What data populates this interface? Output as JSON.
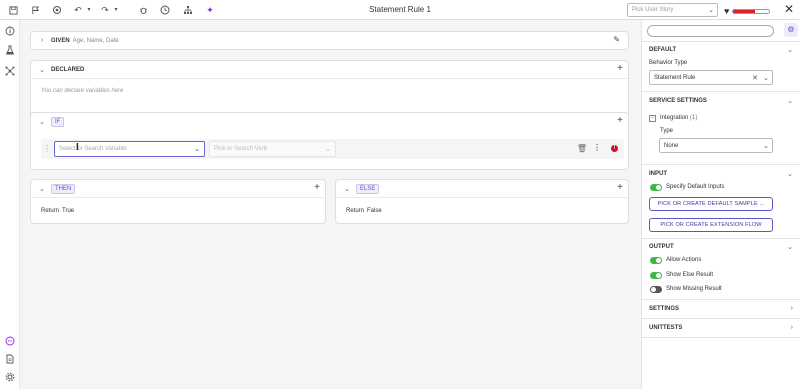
{
  "window": {
    "title": "Statement Rule 1",
    "user_story_placeholder": "Pick User Story",
    "health_fraction": 0.6,
    "toolbar_icons": [
      "save-icon",
      "flag-icon",
      "bug-report-icon",
      "undo-icon",
      "redo-icon",
      "debugger-icon",
      "history-icon",
      "hierarchy-icon",
      "sparkle-icon"
    ]
  },
  "left_rail": {
    "icons": [
      "info-icon",
      "flask-icon",
      "network-icon",
      "chat-icon",
      "document-icon",
      "settings-icon"
    ]
  },
  "sections": {
    "given": {
      "label": "GIVEN",
      "sublabel": "Age, Name, Date"
    },
    "declared": {
      "label": "DECLARED",
      "placeholder": "You can declare variables here"
    },
    "if": {
      "label": "IF",
      "variable_placeholder": "Select or Search Variable",
      "verb_placeholder": "Pick or Search Verb"
    },
    "then": {
      "label": "THEN",
      "return_label": "Return",
      "return_value": "True"
    },
    "else": {
      "label": "ELSE",
      "return_label": "Return",
      "return_value": "False"
    }
  },
  "right_panel": {
    "default": {
      "title": "DEFAULT",
      "behavior_type_label": "Behavior Type",
      "behavior_type_value": "Statement Rule"
    },
    "service_settings": {
      "title": "SERVICE SETTINGS",
      "integration_label": "Integration",
      "integration_count": "(1)",
      "type_label": "Type",
      "type_value": "None"
    },
    "input": {
      "title": "INPUT",
      "specify_default_inputs": "Specify Default Inputs",
      "sample_button": "PICK OR CREATE DEFAULT SAMPLE ...",
      "extension_button": "PICK OR CREATE EXTENSION FLOW"
    },
    "output": {
      "title": "OUTPUT",
      "toggles": [
        {
          "label": "Allow Actions",
          "on": true
        },
        {
          "label": "Show Else Result",
          "on": true
        },
        {
          "label": "Show Missing Result",
          "on": false
        }
      ]
    },
    "settings": {
      "title": "SETTINGS"
    },
    "unittests": {
      "title": "UNITTESTS"
    }
  }
}
